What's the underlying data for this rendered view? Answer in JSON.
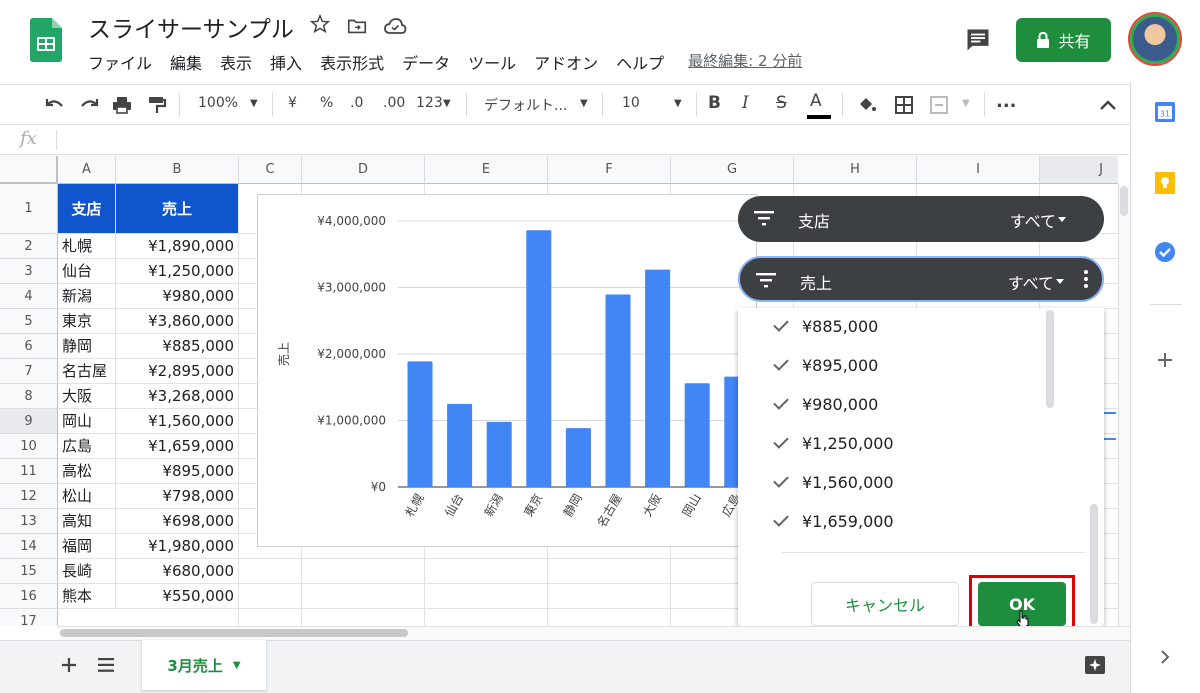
{
  "app": {
    "title": "スライサーサンプル",
    "share_label": "共有",
    "last_edit": "最終編集: 2 分前"
  },
  "menu": [
    "ファイル",
    "編集",
    "表示",
    "挿入",
    "表示形式",
    "データ",
    "ツール",
    "アドオン",
    "ヘルプ"
  ],
  "toolbar": {
    "zoom": "100%",
    "currency": "¥",
    "percent": "%",
    "decrease_decimal": ".0",
    "increase_decimal": ".00",
    "format_more": "123",
    "font": "デフォルト...",
    "font_size": "10",
    "bold": "B",
    "italic": "I",
    "strike": "S",
    "text_color": "A",
    "more": "..."
  },
  "formula_bar": {
    "fx": "fx"
  },
  "columns": [
    "A",
    "B",
    "C",
    "D",
    "E",
    "F",
    "G",
    "H",
    "I",
    "J"
  ],
  "rows": [
    "1",
    "2",
    "3",
    "4",
    "5",
    "6",
    "7",
    "8",
    "9",
    "10",
    "11",
    "12",
    "13",
    "14",
    "15",
    "16",
    "17"
  ],
  "table": {
    "headers": [
      "支店",
      "売上"
    ],
    "data": [
      [
        "札幌",
        "¥1,890,000"
      ],
      [
        "仙台",
        "¥1,250,000"
      ],
      [
        "新潟",
        "¥980,000"
      ],
      [
        "東京",
        "¥3,860,000"
      ],
      [
        "静岡",
        "¥885,000"
      ],
      [
        "名古屋",
        "¥2,895,000"
      ],
      [
        "大阪",
        "¥3,268,000"
      ],
      [
        "岡山",
        "¥1,560,000"
      ],
      [
        "広島",
        "¥1,659,000"
      ],
      [
        "高松",
        "¥895,000"
      ],
      [
        "松山",
        "¥798,000"
      ],
      [
        "高知",
        "¥698,000"
      ],
      [
        "福岡",
        "¥1,980,000"
      ],
      [
        "長崎",
        "¥680,000"
      ],
      [
        "熊本",
        "¥550,000"
      ]
    ]
  },
  "chart_data": {
    "type": "bar",
    "ylabel": "売上",
    "yticks": [
      "¥0",
      "¥1,000,000",
      "¥2,000,000",
      "¥3,000,000",
      "¥4,000,000"
    ],
    "ylim": [
      0,
      4000000
    ],
    "categories": [
      "札幌",
      "仙台",
      "新潟",
      "東京",
      "静岡",
      "名古屋",
      "大阪",
      "岡山",
      "広島"
    ],
    "values": [
      1890000,
      1250000,
      980000,
      3860000,
      885000,
      2895000,
      3268000,
      1560000,
      1659000
    ],
    "bar_color": "#4285f4"
  },
  "slicers": [
    {
      "label": "支店",
      "value": "すべて"
    },
    {
      "label": "売上",
      "value": "すべて"
    }
  ],
  "filter_options": [
    "¥885,000",
    "¥895,000",
    "¥980,000",
    "¥1,250,000",
    "¥1,560,000",
    "¥1,659,000"
  ],
  "buttons": {
    "cancel": "キャンセル",
    "ok": "OK"
  },
  "sheet_tab": {
    "label": "3月売上"
  },
  "colors": {
    "brand_green": "#1e8e3e",
    "header_blue": "#1155cc",
    "highlight_red": "#e00000"
  }
}
